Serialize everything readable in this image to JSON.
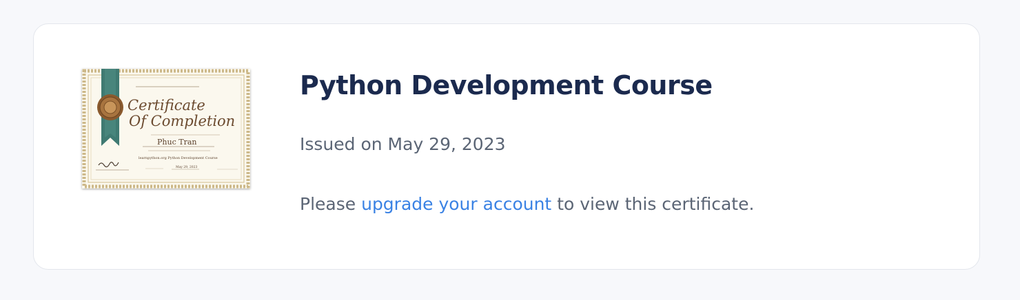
{
  "certificate": {
    "course_title": "Python Development Course",
    "issued_text": "Issued on May 29, 2023",
    "notice_prefix": "Please",
    "upgrade_link_text": "upgrade your account",
    "notice_suffix": "to view this certificate.",
    "thumbnail": {
      "heading_line1": "Certificate",
      "heading_line2": "Of Completion",
      "recipient": "Phuc Tran",
      "course_line": "learnpython.org Python Development Course",
      "date": "May 29, 2023"
    }
  },
  "colors": {
    "page_background": "#f7f8fb",
    "card_background": "#ffffff",
    "title": "#1b2a4e",
    "body_text": "#5b6575",
    "link": "#3a82e4",
    "ribbon": "#3f7a72",
    "seal": "#8a5a2e"
  }
}
